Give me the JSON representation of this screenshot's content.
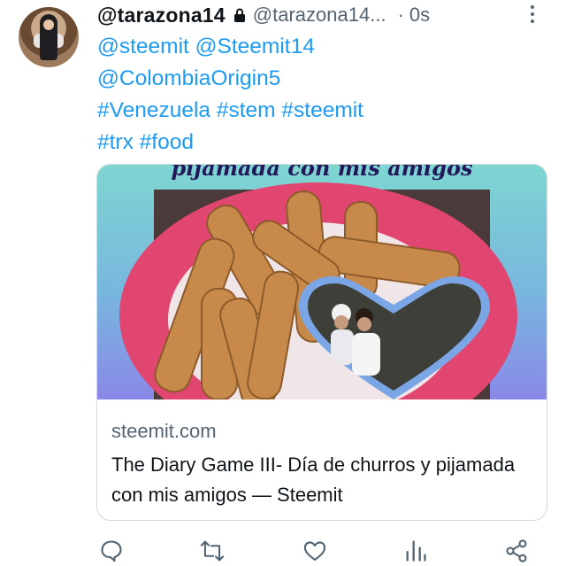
{
  "tweet": {
    "display_name": "@tarazona14",
    "handle": "@tarazona14...",
    "time": "0s",
    "text_lines": [
      "@steemit @Steemit14",
      "@ColombiaOrigin5",
      "#Venezuela #stem #steemit",
      "#trx #food"
    ]
  },
  "card": {
    "image_caption": "pijamada con mis amigos",
    "domain": "steemit.com",
    "title": "The Diary Game III- Día de churros y pijamada con mis amigos — Steemit"
  },
  "icons": {
    "lock": "lock-icon",
    "more": "more-icon",
    "reply": "reply-icon",
    "retweet": "retweet-icon",
    "like": "heart-icon",
    "views": "views-icon",
    "share": "share-icon"
  },
  "colors": {
    "link": "#1d9bf0",
    "text": "#0f1419",
    "muted": "#536471",
    "border": "#cfd9de"
  }
}
